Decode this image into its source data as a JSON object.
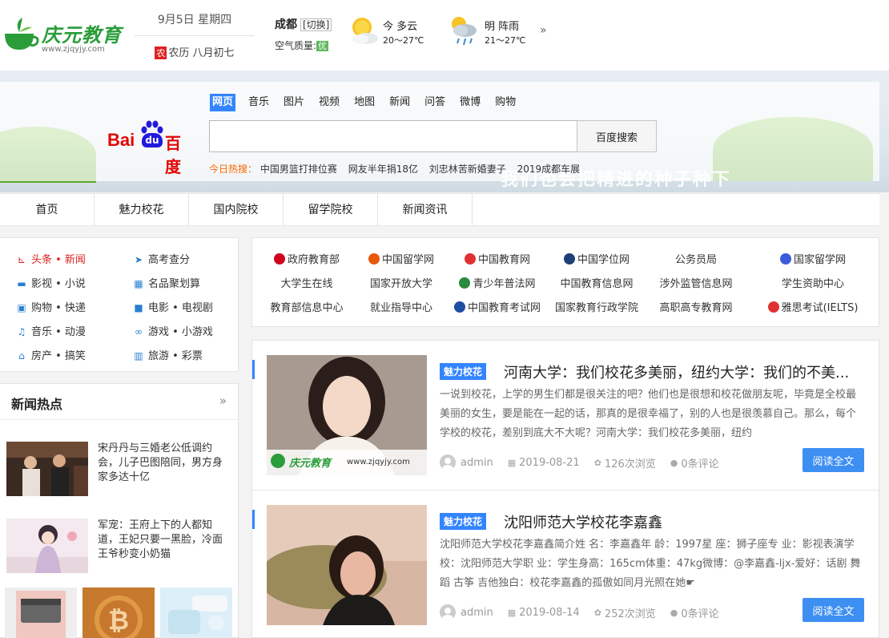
{
  "header": {
    "logo_text": "庆元教育",
    "logo_url": "www.zjqyjy.com",
    "date": "9月5日 星期四",
    "lunar_badge": "农",
    "lunar": "农历 八月初七",
    "city": "成都",
    "city_switch": "[切换]",
    "air_label": "空气质量:",
    "air_value": "优",
    "weather_today_day": "今 多云",
    "weather_today_temp": "20～27℃",
    "weather_tomorrow_day": "明 阵雨",
    "weather_tomorrow_temp": "21～27℃",
    "more": "»"
  },
  "banner": {
    "slogan": "我们也会把精进的种子种下"
  },
  "search": {
    "baidu_text": "Bai",
    "baidu_du": "du",
    "baidu_cn": "百度",
    "tabs": [
      "网页",
      "音乐",
      "图片",
      "视频",
      "地图",
      "新闻",
      "问答",
      "微博",
      "购物"
    ],
    "input_value": "",
    "button": "百度搜索",
    "hot_label": "今日热搜：",
    "hot_items": [
      "中国男篮打排位赛",
      "网友半年捐18亿",
      "刘忠林苦新婚妻子",
      "2019成都车展"
    ]
  },
  "nav": [
    "首页",
    "魅力校花",
    "国内院校",
    "留学院校",
    "新闻资讯"
  ],
  "quick_links": [
    {
      "icon": "headline-icon",
      "glyph": "⊾",
      "label": "头条 • 新闻"
    },
    {
      "icon": "paper-plane-icon",
      "glyph": "➤",
      "label": "高考查分"
    },
    {
      "icon": "cart-icon",
      "glyph": "🛒",
      "label": "影视 • 小说"
    },
    {
      "icon": "film-icon",
      "glyph": "▦",
      "label": "名品聚划算"
    },
    {
      "icon": "shopping-bag-icon",
      "glyph": "▣",
      "label": "购物 • 快递"
    },
    {
      "icon": "video-camera-icon",
      "glyph": "■",
      "label": "电影 • 电视剧"
    },
    {
      "icon": "music-icon",
      "glyph": "♫",
      "label": "音乐 • 动漫"
    },
    {
      "icon": "gamepad-icon",
      "glyph": "∞",
      "label": "游戏 • 小游戏"
    },
    {
      "icon": "home-icon",
      "glyph": "⌂",
      "label": "房产 • 搞笑"
    },
    {
      "icon": "map-icon",
      "glyph": "▥",
      "label": "旅游 • 彩票"
    }
  ],
  "news_hot": {
    "title": "新闻热点",
    "more": "»",
    "items": [
      "宋丹丹与三婚老公低调约会，儿子巴图陪同，男方身家多达十亿",
      "军宠：王府上下的人都知道，王妃只要一黑脸，冷面王爷秒变小奶猫"
    ]
  },
  "edu_links": [
    {
      "label": "政府教育部",
      "color": "#d0021b"
    },
    {
      "label": "中国留学网",
      "color": "#e8590c"
    },
    {
      "label": "中国教育网",
      "color": "#e03131"
    },
    {
      "label": "中国学位网",
      "color": "#1c3f7a"
    },
    {
      "label": "公务员局",
      "color": ""
    },
    {
      "label": "国家留学网",
      "color": "#3b5bdb"
    },
    {
      "label": "大学生在线",
      "color": ""
    },
    {
      "label": "国家开放大学",
      "color": ""
    },
    {
      "label": "青少年普法网",
      "color": "#2b8a3e"
    },
    {
      "label": "中国教育信息网",
      "color": ""
    },
    {
      "label": "涉外监管信息网",
      "color": ""
    },
    {
      "label": "学生资助中心",
      "color": ""
    },
    {
      "label": "教育部信息中心",
      "color": ""
    },
    {
      "label": "就业指导中心",
      "color": ""
    },
    {
      "label": "中国教育考试网",
      "color": "#1c4fa0"
    },
    {
      "label": "国家教育行政学院",
      "color": ""
    },
    {
      "label": "高职高专教育网",
      "color": ""
    },
    {
      "label": "雅思考试(IELTS)",
      "color": "#e03131"
    }
  ],
  "articles": [
    {
      "tag": "魅力校花",
      "title": "河南大学：我们校花多美丽，纽约大学：我们的不美...",
      "summary": "一说到校花，上学的男生们都是很关注的吧？他们也是很想和校花做朋友呢，毕竟是全校最美丽的女生，要是能在一起的话，那真的是很幸福了，别的人也是很羡慕自己。那么，每个学校的校花，差别到底大不大呢？河南大学：我们校花多美丽，纽约",
      "author": "admin",
      "date": "2019-08-21",
      "views": "126次浏览",
      "comments": "0条评论",
      "read": "阅读全文",
      "watermark_logo": "庆元教育",
      "watermark_url": "www.zjqyjy.com"
    },
    {
      "tag": "魅力校花",
      "title": "沈阳师范大学校花李嘉鑫",
      "summary": "沈阳师范大学校花李嘉鑫简介姓 名：李嘉鑫年 龄：1997星 座：狮子座专 业：影视表演学 校：沈阳师范大学职 业：学生身高：165cm体重：47kg微博：@李嘉鑫-ljx-爱好：话剧 舞蹈 古筝 吉他独白：校花李嘉鑫的孤傲如同月光照在她☛",
      "author": "admin",
      "date": "2019-08-14",
      "views": "252次浏览",
      "comments": "0条评论",
      "read": "阅读全文"
    }
  ]
}
